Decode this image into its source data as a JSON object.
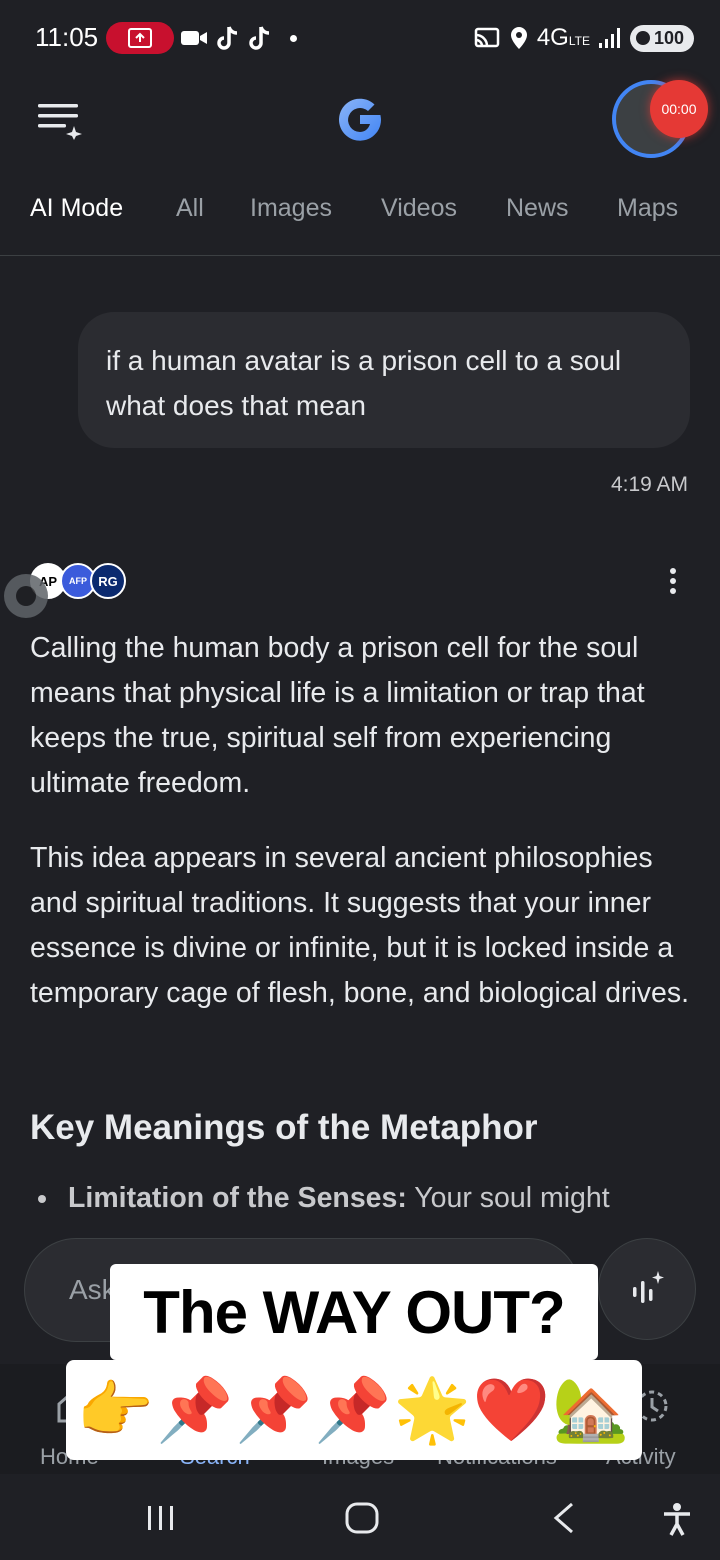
{
  "status_bar": {
    "time": "11:05",
    "network": "4G",
    "network_sub": "LTE",
    "battery": "100"
  },
  "header": {
    "recording_timer": "00:00"
  },
  "tabs": [
    {
      "label": "AI Mode",
      "active": true
    },
    {
      "label": "All"
    },
    {
      "label": "Images"
    },
    {
      "label": "Videos"
    },
    {
      "label": "News"
    },
    {
      "label": "Maps"
    }
  ],
  "conversation": {
    "query": "if a human avatar is a prison cell to a soul what does that mean",
    "query_time": "4:19 AM",
    "sources": [
      "AP",
      "AFP",
      "RG"
    ],
    "answer_paragraphs": [
      "Calling the human body a prison cell for the soul means that physical life is a limitation or trap that keeps the true, spiritual self from experiencing ultimate freedom.",
      "This idea appears in several ancient philosophies and spiritual traditions. It suggests that your inner essence is divine or infinite, but it is locked inside a temporary cage of flesh, bone, and biological drives."
    ],
    "section_heading": "Key Meanings of the Metaphor",
    "bullet_title": "Limitation of the Senses:",
    "bullet_text": "Your soul might"
  },
  "ask_bar": {
    "placeholder": "Ask"
  },
  "bottom_nav": [
    {
      "label": "Home"
    },
    {
      "label": "Search"
    },
    {
      "label": "Images"
    },
    {
      "label": "Notifications"
    },
    {
      "label": "Activity"
    }
  ],
  "overlay_caption": {
    "line1": "The WAY OUT?",
    "line2": "👉📌📌📌🌟❤️🏡"
  },
  "colors": {
    "background": "#1f2025",
    "accent_blue": "#4285f4",
    "record_red": "#e53935"
  }
}
